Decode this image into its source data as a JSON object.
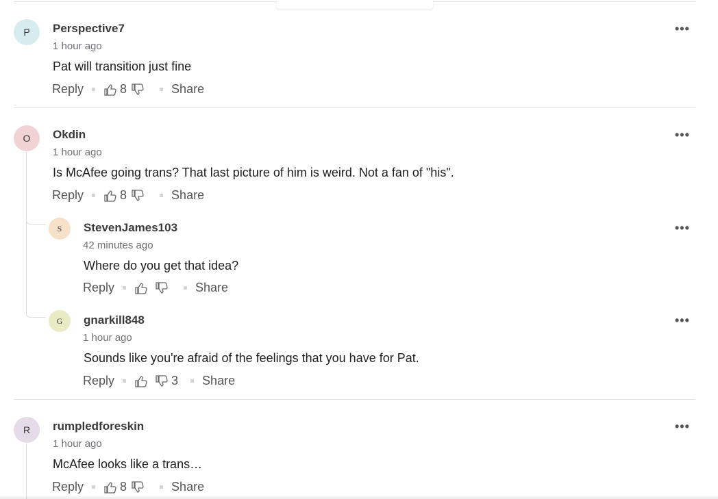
{
  "comments": [
    {
      "avatar_letter": "P",
      "avatar_color": "#d6ecef",
      "username": "Perspective7",
      "time": "1 hour ago",
      "text": "Pat will transition just fine",
      "reply_label": "Reply",
      "likes": "8",
      "dislikes": "",
      "share_label": "Share"
    },
    {
      "avatar_letter": "O",
      "avatar_color": "#f2d3d3",
      "username": "Okdin",
      "time": "1 hour ago",
      "text": "Is McAfee going trans?  That last picture of him is weird.  Not a fan of \"his\".",
      "reply_label": "Reply",
      "likes": "8",
      "dislikes": "",
      "share_label": "Share",
      "replies": [
        {
          "avatar_letter": "S",
          "avatar_color": "#f6e1c8",
          "username": "StevenJames103",
          "time": "42 minutes ago",
          "text": "Where do you get that idea?",
          "reply_label": "Reply",
          "likes": "",
          "dislikes": "",
          "share_label": "Share"
        },
        {
          "avatar_letter": "G",
          "avatar_color": "#e8ebc4",
          "username": "gnarkill848",
          "time": "1 hour ago",
          "text": "Sounds like you're afraid of the feelings that you have for Pat.",
          "reply_label": "Reply",
          "likes": "",
          "dislikes": "3",
          "share_label": "Share"
        }
      ]
    },
    {
      "avatar_letter": "R",
      "avatar_color": "#e6dbe8",
      "username": "rumpledforeskin",
      "time": "1 hour ago",
      "text": "McAfee looks like a trans…",
      "reply_label": "Reply",
      "likes": "8",
      "dislikes": "",
      "share_label": "Share"
    }
  ],
  "more_label": "•••",
  "icons": {
    "like": "thumbs-up-icon",
    "dislike": "thumbs-down-icon",
    "more": "more-options-icon"
  }
}
